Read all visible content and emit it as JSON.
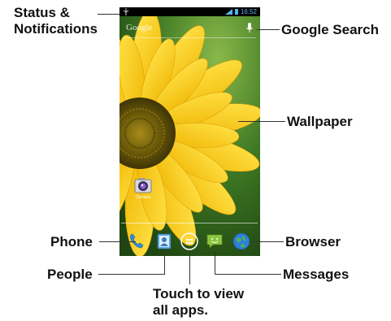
{
  "labels": {
    "status": "Status &\nNotifications",
    "google_search": "Google Search",
    "wallpaper": "Wallpaper",
    "phone": "Phone",
    "browser": "Browser",
    "people": "People",
    "messages": "Messages",
    "all_apps": "Touch to view\nall apps."
  },
  "screen": {
    "status_time": "16:52",
    "search_logo": "Google",
    "camera_label": "Camera"
  },
  "colors": {
    "status_icons": "#5ab4e6",
    "wallpaper_petal": "#f5c400",
    "wallpaper_center": "#6b5a08",
    "wallpaper_background": "#2b5a1a"
  }
}
